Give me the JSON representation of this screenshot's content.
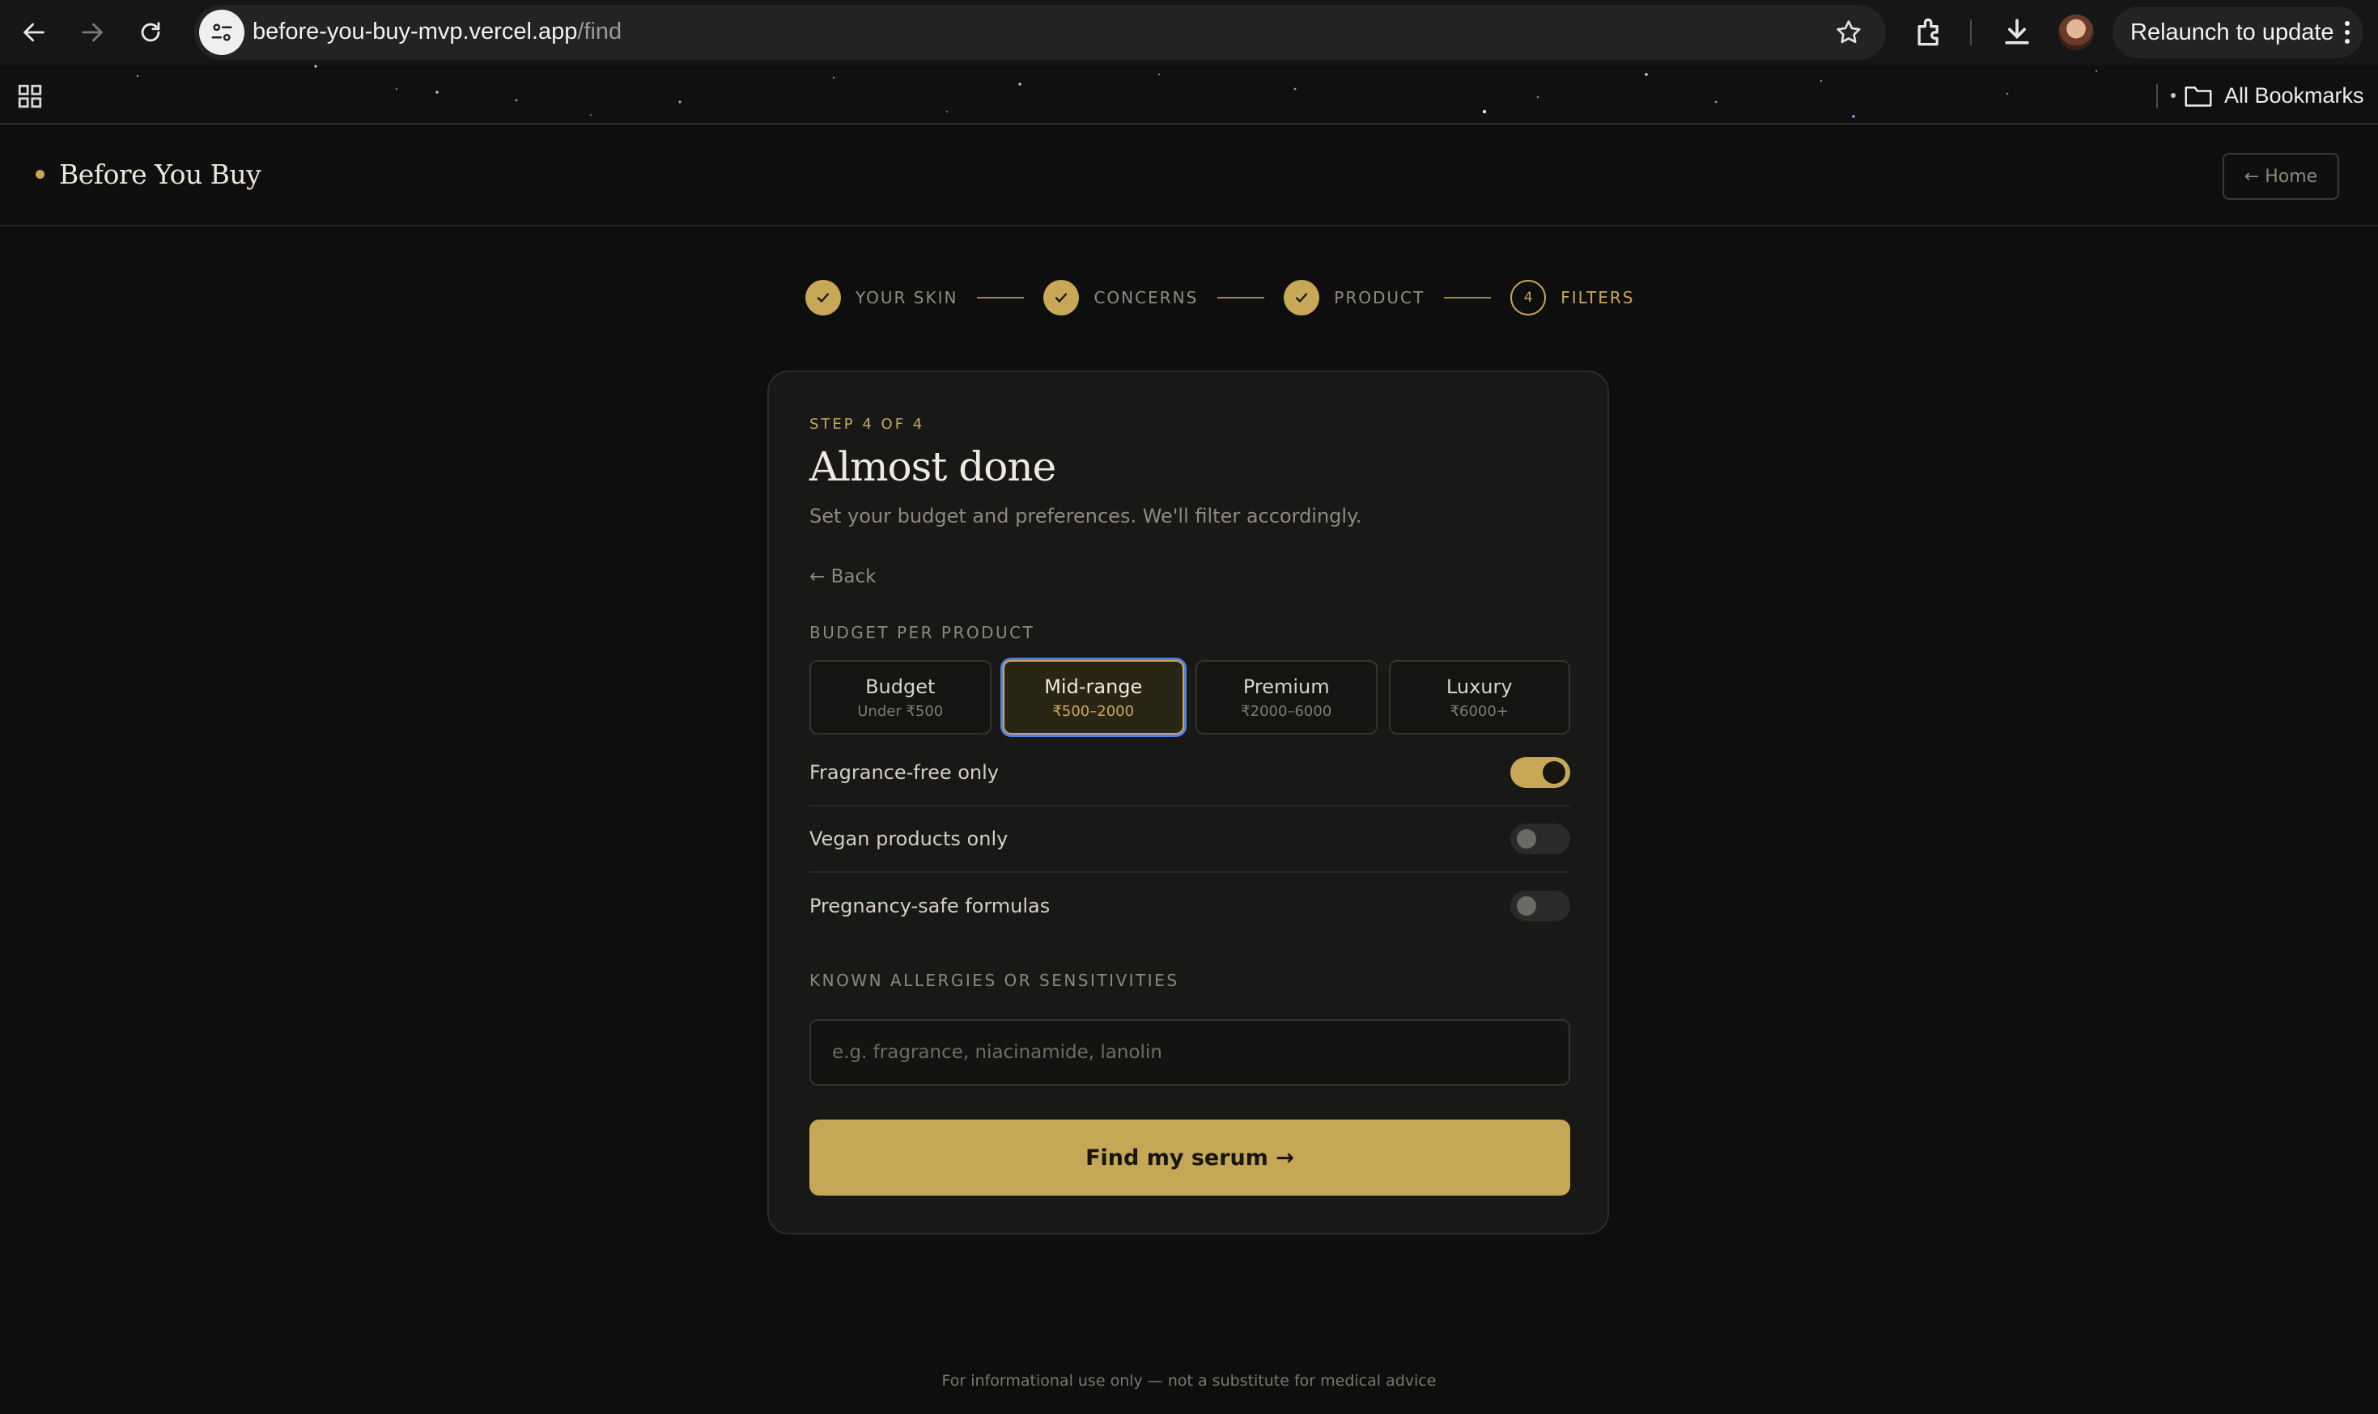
{
  "browser": {
    "url_host": "before-you-buy-mvp.vercel.app",
    "url_path": "/find",
    "relaunch_label": "Relaunch to update",
    "bookmarks_label": "All Bookmarks"
  },
  "header": {
    "brand": "Before You Buy",
    "home_label": "← Home"
  },
  "stepper": {
    "steps": [
      {
        "label": "YOUR SKIN",
        "state": "done"
      },
      {
        "label": "CONCERNS",
        "state": "done"
      },
      {
        "label": "PRODUCT",
        "state": "done"
      },
      {
        "label": "FILTERS",
        "state": "current",
        "number": "4"
      }
    ]
  },
  "card": {
    "eyebrow": "STEP 4 OF 4",
    "title": "Almost done",
    "subtitle": "Set your budget and preferences. We'll filter accordingly.",
    "back_label": "← Back",
    "budget_label": "BUDGET PER PRODUCT",
    "budget_options": [
      {
        "name": "Budget",
        "range": "Under ₹500",
        "selected": false
      },
      {
        "name": "Mid-range",
        "range": "₹500–2000",
        "selected": true
      },
      {
        "name": "Premium",
        "range": "₹2000–6000",
        "selected": false
      },
      {
        "name": "Luxury",
        "range": "₹6000+",
        "selected": false
      }
    ],
    "toggles": [
      {
        "label": "Fragrance-free only",
        "on": true
      },
      {
        "label": "Vegan products only",
        "on": false
      },
      {
        "label": "Pregnancy-safe formulas",
        "on": false
      }
    ],
    "allergies_label": "KNOWN ALLERGIES OR SENSITIVITIES",
    "allergies_placeholder": "e.g. fragrance, niacinamide, lanolin",
    "allergies_value": "",
    "cta_label": "Find my serum →"
  },
  "footer": {
    "text": "For informational use only — not a substitute for medical advice"
  },
  "colors": {
    "accent": "#c8a857",
    "background": "#0e0e0e",
    "card": "#181816",
    "focus_ring": "#4e82e8"
  }
}
